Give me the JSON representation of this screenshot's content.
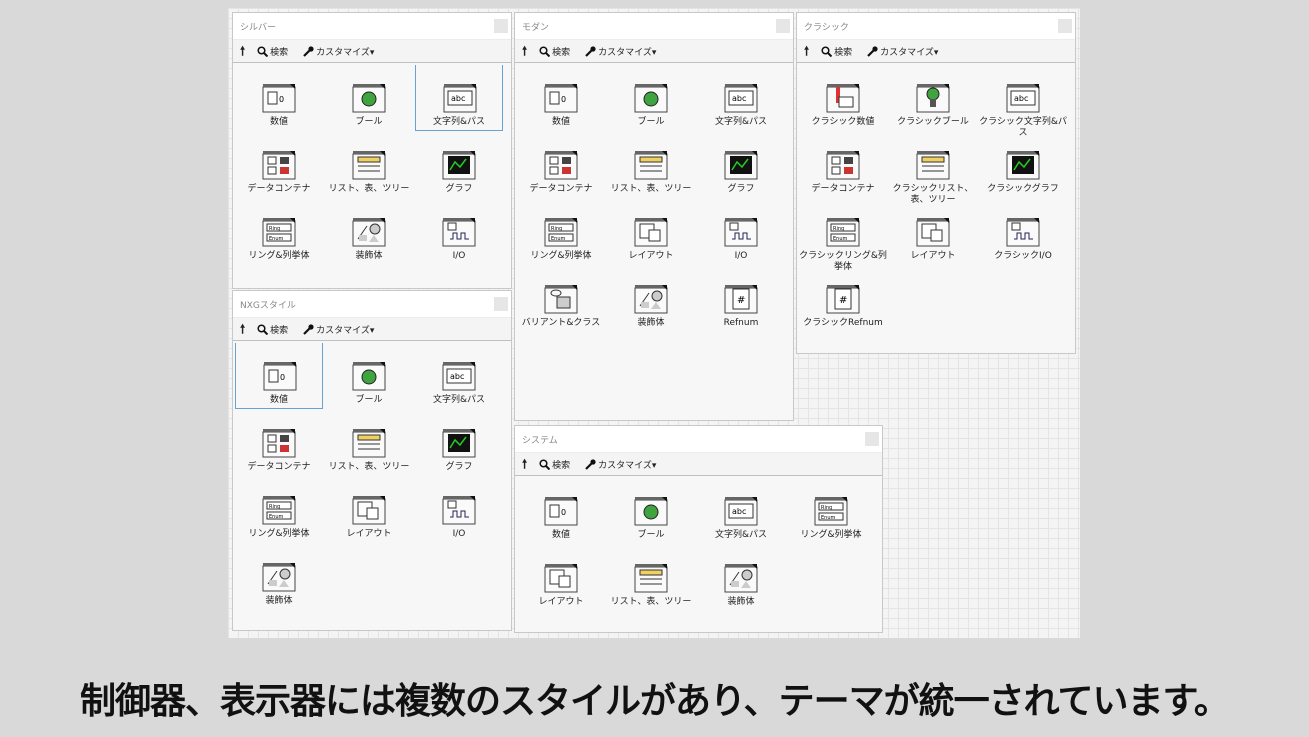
{
  "toolbar": {
    "search": "検索",
    "customize": "カスタマイズ▾"
  },
  "palettes": {
    "silver": {
      "title": "シルバー",
      "items": [
        "数値",
        "ブール",
        "文字列&パス",
        "データコンテナ",
        "リスト、表、ツリー",
        "グラフ",
        "リング&列挙体",
        "装飾体",
        "I/O"
      ]
    },
    "modern": {
      "title": "モダン",
      "items": [
        "数値",
        "ブール",
        "文字列&パス",
        "データコンテナ",
        "リスト、表、ツリー",
        "グラフ",
        "リング&列挙体",
        "レイアウト",
        "I/O",
        "バリアント&クラス",
        "装飾体",
        "Refnum"
      ]
    },
    "classic": {
      "title": "クラシック",
      "items": [
        "クラシック数値",
        "クラシックブール",
        "クラシック文字列&パス",
        "データコンテナ",
        "クラシックリスト、表、ツリー",
        "クラシックグラフ",
        "クラシックリング&列挙体",
        "レイアウト",
        "クラシックI/O",
        "クラシックRefnum"
      ]
    },
    "nxg": {
      "title": "NXGスタイル",
      "items": [
        "数値",
        "ブール",
        "文字列&パス",
        "データコンテナ",
        "リスト、表、ツリー",
        "グラフ",
        "リング&列挙体",
        "レイアウト",
        "I/O",
        "装飾体"
      ]
    },
    "system": {
      "title": "システム",
      "items": [
        "数値",
        "ブール",
        "文字列&パス",
        "リング&列挙体",
        "レイアウト",
        "リスト、表、ツリー",
        "装飾体"
      ]
    }
  },
  "caption": "制御器、表示器には複数のスタイルがあり、テーマが統一されています。"
}
